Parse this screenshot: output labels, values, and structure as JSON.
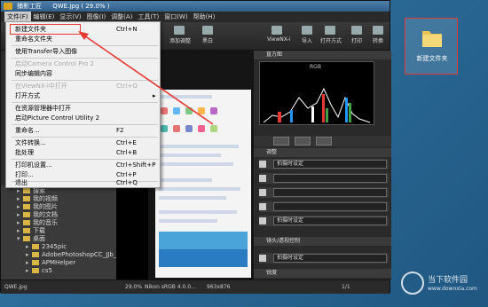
{
  "window": {
    "app_name": "捕影工匠",
    "file_title": "QWE.jpg ( 29.0% )"
  },
  "menubar": [
    "文件(F)",
    "编辑(E)",
    "显示(V)",
    "图像(I)",
    "调整(A)",
    "工具(T)",
    "窗口(W)",
    "帮助(H)"
  ],
  "toolbar": {
    "left_labels": [
      "添加调整",
      "黑白"
    ],
    "right_labels": [
      "ViewNX-i",
      "导入",
      "打开方式",
      "打印",
      "转换"
    ]
  },
  "file_menu": [
    {
      "label": "新建文件夹",
      "shortcut": "Ctrl+N",
      "disabled": false
    },
    {
      "label": "重命名文件夹",
      "shortcut": "",
      "disabled": false
    },
    {
      "label": "使用Transfer导入图像",
      "shortcut": "",
      "disabled": false
    },
    {
      "label": "启动Camera Control Pro 2",
      "shortcut": "",
      "disabled": true
    },
    {
      "label": "同步编辑内容",
      "shortcut": "",
      "disabled": false
    },
    {
      "label": "在ViewNX-i中打开",
      "shortcut": "Ctrl+O",
      "disabled": true
    },
    {
      "label": "打开方式",
      "shortcut": "▸",
      "disabled": false
    },
    {
      "label": "在资源管理器中打开",
      "shortcut": "",
      "disabled": false
    },
    {
      "label": "启动Picture Control Utility 2",
      "shortcut": "",
      "disabled": false
    },
    {
      "label": "重命名...",
      "shortcut": "F2",
      "disabled": false
    },
    {
      "label": "文件转换...",
      "shortcut": "Ctrl+E",
      "disabled": false
    },
    {
      "label": "批处理",
      "shortcut": "Ctrl+B",
      "disabled": false
    },
    {
      "label": "打印机设置...",
      "shortcut": "Ctrl+Shift+P",
      "disabled": false
    },
    {
      "label": "打印...",
      "shortcut": "Ctrl+P",
      "disabled": false
    },
    {
      "label": "退出",
      "shortcut": "Ctrl+Q",
      "disabled": false
    }
  ],
  "tree": [
    {
      "label": "搜索",
      "level": 1
    },
    {
      "label": "我的视频",
      "level": 1
    },
    {
      "label": "我的图片",
      "level": 1
    },
    {
      "label": "我的文档",
      "level": 1
    },
    {
      "label": "我的音乐",
      "level": 1
    },
    {
      "label": "下载",
      "level": 1
    },
    {
      "label": "桌面",
      "level": 1
    },
    {
      "label": "2345pic",
      "level": 2
    },
    {
      "label": "AdobePhotoshopCC_JJb_",
      "level": 2
    },
    {
      "label": "APMHelper",
      "level": 2
    },
    {
      "label": "cs5",
      "level": 2
    }
  ],
  "right_panel": {
    "histogram_header": "直方图",
    "histogram_mode": "RGB",
    "adjust_header": "调整",
    "picture_control_label": "拍摄时设定",
    "lens_header": "镜头/透视控制",
    "lens_value": "拍摄时设定",
    "bottom_label": "锐度"
  },
  "status": {
    "filename": "QWE.jpg",
    "zoom": "29.0%",
    "color_profile": "Nikon sRGB 4.0.0...",
    "dimensions": "963x876",
    "page": "1/1"
  },
  "desktop": {
    "folder_label": "新建文件夹",
    "watermark_title": "当下软件园",
    "watermark_sub": "www.downxia.com"
  }
}
